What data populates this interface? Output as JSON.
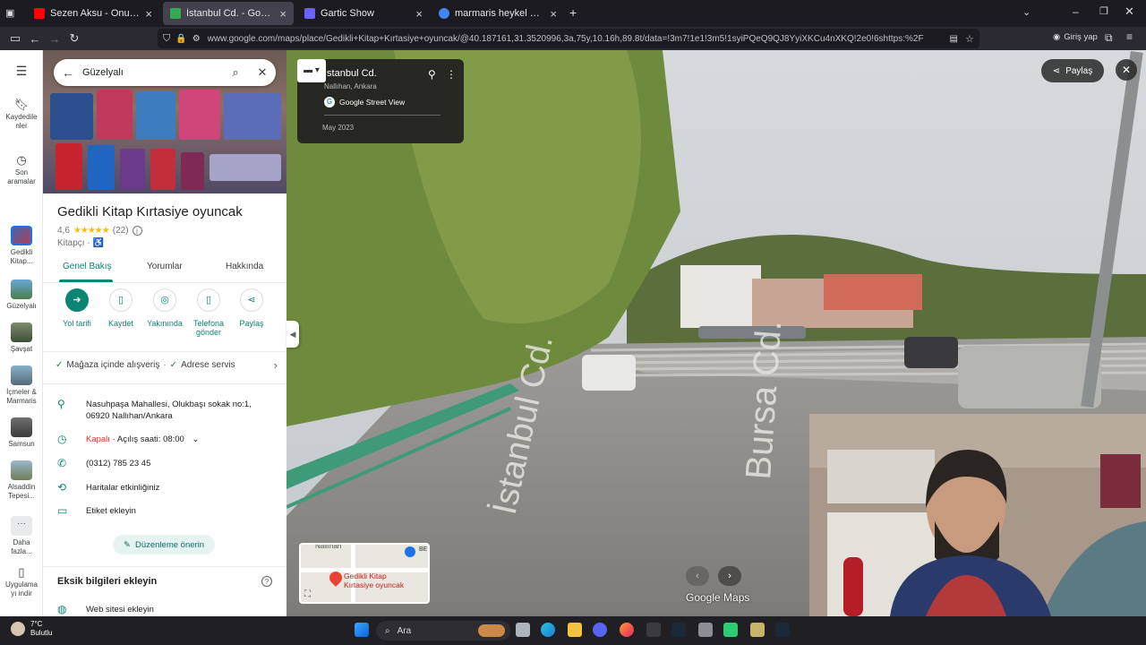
{
  "browser": {
    "tabs": [
      {
        "label": "Sezen Aksu - Onu Alma Beni Al",
        "color": "#ff0000",
        "active": false
      },
      {
        "label": "İstanbul Cd. - Google Haritalar",
        "color": "#34a853",
        "active": true
      },
      {
        "label": "Gartic Show",
        "color": "#6c63ff",
        "active": false
      },
      {
        "label": "marmaris heykel deniz içinde -",
        "color": "#4285f4",
        "active": false
      }
    ],
    "url": "www.google.com/maps/place/Gedikli+Kitap+Kırtasiye+oyuncak/@40.187161,31.3520996,3a,75y,10.16h,89.8t/data=!3m7!1e1!3m5!1syiPQeQ9QJ8YyiXKCu4nXKQ!2e0!6shttps:%2F%2Fstreetviewpixe",
    "signin_label": "Giriş yap"
  },
  "rail": {
    "items": [
      {
        "label": "Kaydedile\nnler",
        "icon": "bookmark-icon"
      },
      {
        "label": "Son\naramalar",
        "icon": "history-icon"
      },
      {
        "label": "Gedikli\nKitap...",
        "icon": "thumb"
      },
      {
        "label": "Güzelyalı",
        "icon": "thumb"
      },
      {
        "label": "Şavşat",
        "icon": "thumb"
      },
      {
        "label": "İçmeler &\nMarmaris",
        "icon": "thumb"
      },
      {
        "label": "Samsun",
        "icon": "thumb"
      },
      {
        "label": "Alsaddin\nTepesi...",
        "icon": "thumb"
      },
      {
        "label": "Daha\nfazla...",
        "icon": "more-icon"
      },
      {
        "label": "Uygulama\nyı indir",
        "icon": "phone-icon"
      }
    ]
  },
  "search": {
    "value": "Güzelyalı"
  },
  "place": {
    "title": "Gedikli Kitap Kırtasiye oyuncak",
    "rating": "4,6",
    "stars": "★★★★★",
    "reviews": "(22)",
    "category": "Kitapçı · ♿",
    "tabs": [
      "Genel Bakış",
      "Yorumlar",
      "Hakkında"
    ],
    "actions": [
      {
        "label": "Yol tarifi",
        "icon": "directions-icon"
      },
      {
        "label": "Kaydet",
        "icon": "bookmark-icon"
      },
      {
        "label": "Yakınında",
        "icon": "nearby-icon"
      },
      {
        "label": "Telefona\ngönder",
        "icon": "send-to-phone-icon"
      },
      {
        "label": "Paylaş",
        "icon": "share-icon"
      }
    ],
    "services": [
      "Mağaza içinde alışveriş",
      "Adrese servis"
    ],
    "address": "Nasuhpaşa Mahallesi, Olukbaşı sokak no:1, 06920 Nallıhan/Ankara",
    "status_closed": "Kapalı",
    "status_open": " · Açılış saati: 08:00",
    "phone": "(0312) 785 23 45",
    "activity": "Haritalar etkinliğiniz",
    "add_label": "Etiket ekleyin",
    "suggest_edit": "Düzenleme önerin",
    "missing_info": "Eksik bilgileri ekleyin",
    "website": "Web sitesi ekleyin"
  },
  "streetview": {
    "street_title": "İstanbul Cd.",
    "street_subtitle": "Nallıhan, Ankara",
    "source": "Google Street View",
    "date": "May 2023",
    "share_label": "Paylaş",
    "road_text_1": "İstanbul Cd.",
    "road_text_2": "Bursa Cd.",
    "brand": "Google Maps",
    "minimap_label": "Gedikli Kitap\nKırtasiye oyuncak",
    "minimap_top": "Nallıhan",
    "minimap_badge": "BE"
  },
  "taskbar": {
    "temperature": "7°C",
    "weather": "Bulutlu",
    "search_label": "Ara"
  }
}
